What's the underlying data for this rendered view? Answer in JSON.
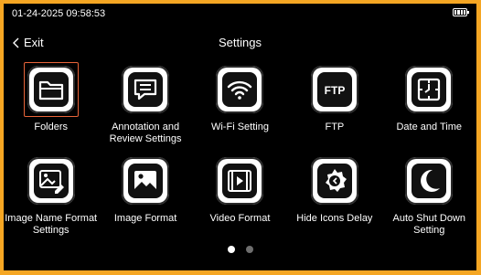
{
  "status": {
    "timestamp": "01-24-2025 09:58:53",
    "battery_icon": "battery-full-icon"
  },
  "header": {
    "exit_label": "Exit",
    "title": "Settings"
  },
  "tiles": [
    {
      "label": "Folders",
      "icon": "folder-icon"
    },
    {
      "label": "Annotation and Review Settings",
      "icon": "annotation-icon"
    },
    {
      "label": "Wi-Fi Setting",
      "icon": "wifi-icon"
    },
    {
      "label": "FTP",
      "icon": "ftp-icon"
    },
    {
      "label": "Date and Time",
      "icon": "clock-icon"
    },
    {
      "label": "Image Name Format Settings",
      "icon": "image-edit-icon"
    },
    {
      "label": "Image Format",
      "icon": "image-icon"
    },
    {
      "label": "Video Format",
      "icon": "video-icon"
    },
    {
      "label": "Hide Icons Delay",
      "icon": "gear-icon"
    },
    {
      "label": "Auto Shut Down Setting",
      "icon": "moon-icon"
    }
  ],
  "pager": {
    "pages": 2,
    "current": 1
  },
  "colors": {
    "frame": "#f5a623",
    "selection": "#e8643a",
    "background": "#000000"
  }
}
